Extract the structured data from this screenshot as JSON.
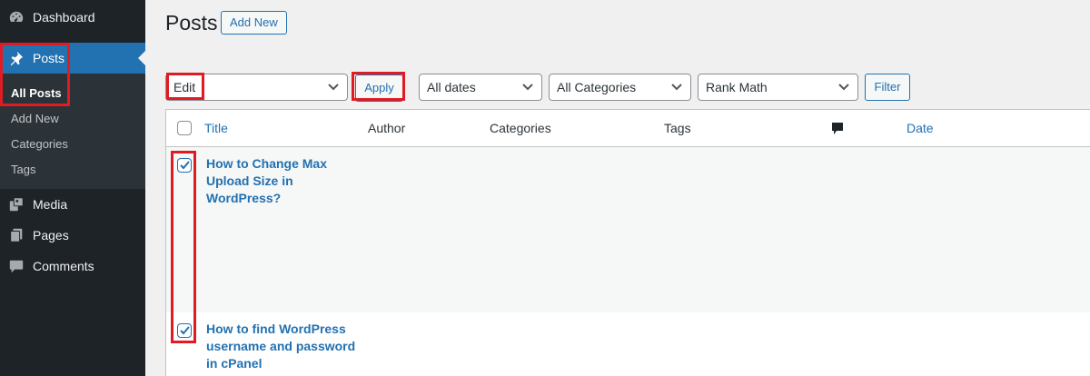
{
  "sidebar": {
    "items": [
      {
        "label": "Dashboard",
        "icon": "dashboard-icon"
      },
      {
        "label": "Posts",
        "icon": "pin-icon",
        "active": true
      },
      {
        "label": "Media",
        "icon": "media-icon"
      },
      {
        "label": "Pages",
        "icon": "pages-icon"
      },
      {
        "label": "Comments",
        "icon": "comments-icon"
      }
    ],
    "submenu": [
      "All Posts",
      "Add New",
      "Categories",
      "Tags"
    ]
  },
  "header": {
    "title": "Posts",
    "add_new_label": "Add New"
  },
  "toolbar": {
    "bulk_action_value": "Edit",
    "apply_label": "Apply",
    "dates_value": "All dates",
    "categories_value": "All Categories",
    "rankmath_value": "Rank Math",
    "filter_label": "Filter"
  },
  "table": {
    "columns": [
      "Title",
      "Author",
      "Categories",
      "Tags",
      "Date"
    ],
    "comments_icon": "comment-bubble-icon",
    "rows": [
      {
        "title": "How to Change Max Upload Size in WordPress?",
        "checked": true
      },
      {
        "title": "How to find WordPress username and password in cPanel",
        "checked": true
      }
    ]
  },
  "colors": {
    "accent": "#2271b1",
    "sidebar_bg": "#1d2327",
    "highlight": "#e11b22"
  }
}
